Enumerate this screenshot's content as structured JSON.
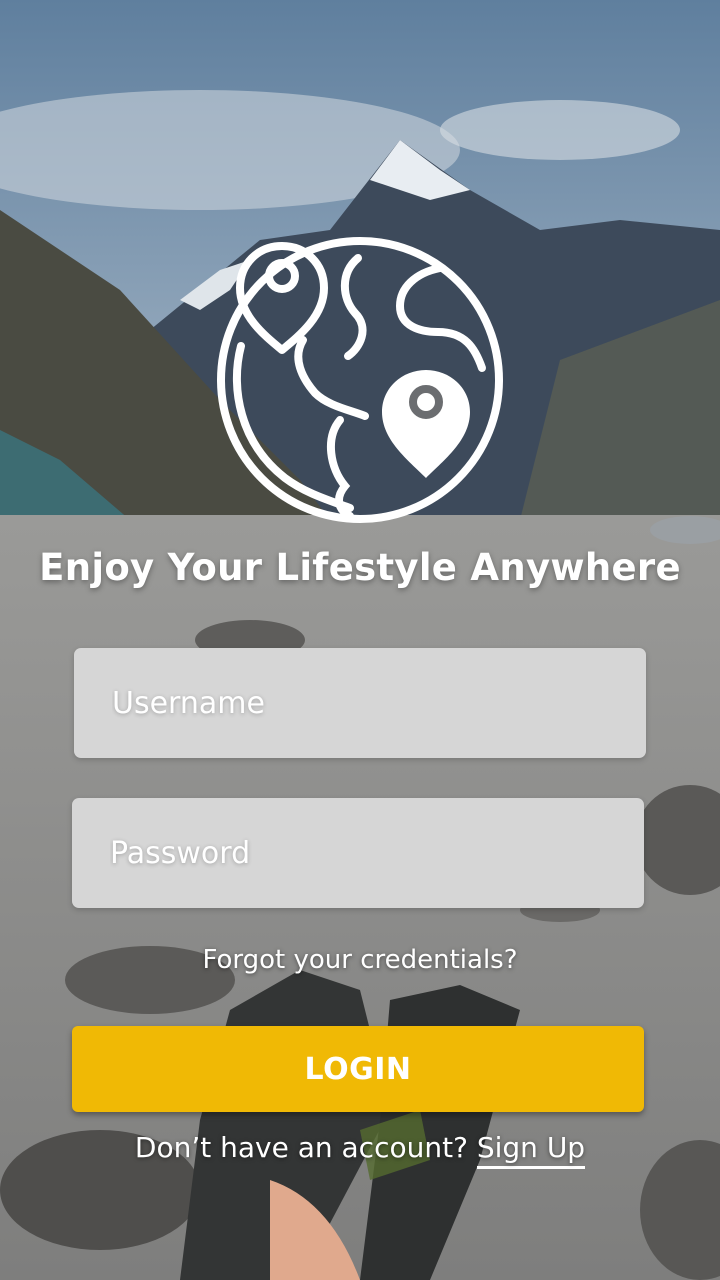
{
  "app": {
    "logo_icon": "globe-with-location-pins-icon",
    "headline": "Enjoy Your Lifestyle Anywhere"
  },
  "form": {
    "username_placeholder": "Username",
    "password_placeholder": "Password",
    "forgot_link": "Forgot your credentials?",
    "login_label": "LOGIN",
    "signup_prompt": "Don’t have an account?",
    "signup_link": "Sign Up"
  },
  "colors": {
    "accent": "#f0b905",
    "field_background": "#d6d6d6",
    "text": "#ffffff"
  },
  "background": {
    "scene": "mountain-lake-with-feet-photo"
  }
}
